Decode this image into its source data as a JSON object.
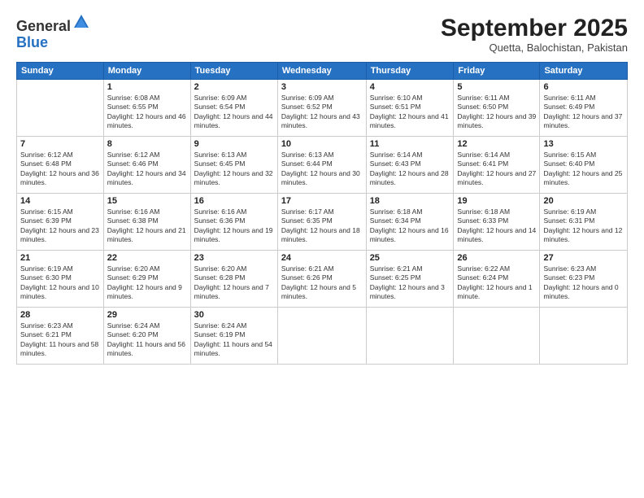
{
  "logo": {
    "general": "General",
    "blue": "Blue"
  },
  "header": {
    "month": "September 2025",
    "location": "Quetta, Balochistan, Pakistan"
  },
  "weekdays": [
    "Sunday",
    "Monday",
    "Tuesday",
    "Wednesday",
    "Thursday",
    "Friday",
    "Saturday"
  ],
  "weeks": [
    [
      {
        "day": "",
        "empty": true
      },
      {
        "day": "1",
        "sunrise": "6:08 AM",
        "sunset": "6:55 PM",
        "daylight": "12 hours and 46 minutes."
      },
      {
        "day": "2",
        "sunrise": "6:09 AM",
        "sunset": "6:54 PM",
        "daylight": "12 hours and 44 minutes."
      },
      {
        "day": "3",
        "sunrise": "6:09 AM",
        "sunset": "6:52 PM",
        "daylight": "12 hours and 43 minutes."
      },
      {
        "day": "4",
        "sunrise": "6:10 AM",
        "sunset": "6:51 PM",
        "daylight": "12 hours and 41 minutes."
      },
      {
        "day": "5",
        "sunrise": "6:11 AM",
        "sunset": "6:50 PM",
        "daylight": "12 hours and 39 minutes."
      },
      {
        "day": "6",
        "sunrise": "6:11 AM",
        "sunset": "6:49 PM",
        "daylight": "12 hours and 37 minutes."
      }
    ],
    [
      {
        "day": "7",
        "sunrise": "6:12 AM",
        "sunset": "6:48 PM",
        "daylight": "12 hours and 36 minutes."
      },
      {
        "day": "8",
        "sunrise": "6:12 AM",
        "sunset": "6:46 PM",
        "daylight": "12 hours and 34 minutes."
      },
      {
        "day": "9",
        "sunrise": "6:13 AM",
        "sunset": "6:45 PM",
        "daylight": "12 hours and 32 minutes."
      },
      {
        "day": "10",
        "sunrise": "6:13 AM",
        "sunset": "6:44 PM",
        "daylight": "12 hours and 30 minutes."
      },
      {
        "day": "11",
        "sunrise": "6:14 AM",
        "sunset": "6:43 PM",
        "daylight": "12 hours and 28 minutes."
      },
      {
        "day": "12",
        "sunrise": "6:14 AM",
        "sunset": "6:41 PM",
        "daylight": "12 hours and 27 minutes."
      },
      {
        "day": "13",
        "sunrise": "6:15 AM",
        "sunset": "6:40 PM",
        "daylight": "12 hours and 25 minutes."
      }
    ],
    [
      {
        "day": "14",
        "sunrise": "6:15 AM",
        "sunset": "6:39 PM",
        "daylight": "12 hours and 23 minutes."
      },
      {
        "day": "15",
        "sunrise": "6:16 AM",
        "sunset": "6:38 PM",
        "daylight": "12 hours and 21 minutes."
      },
      {
        "day": "16",
        "sunrise": "6:16 AM",
        "sunset": "6:36 PM",
        "daylight": "12 hours and 19 minutes."
      },
      {
        "day": "17",
        "sunrise": "6:17 AM",
        "sunset": "6:35 PM",
        "daylight": "12 hours and 18 minutes."
      },
      {
        "day": "18",
        "sunrise": "6:18 AM",
        "sunset": "6:34 PM",
        "daylight": "12 hours and 16 minutes."
      },
      {
        "day": "19",
        "sunrise": "6:18 AM",
        "sunset": "6:33 PM",
        "daylight": "12 hours and 14 minutes."
      },
      {
        "day": "20",
        "sunrise": "6:19 AM",
        "sunset": "6:31 PM",
        "daylight": "12 hours and 12 minutes."
      }
    ],
    [
      {
        "day": "21",
        "sunrise": "6:19 AM",
        "sunset": "6:30 PM",
        "daylight": "12 hours and 10 minutes."
      },
      {
        "day": "22",
        "sunrise": "6:20 AM",
        "sunset": "6:29 PM",
        "daylight": "12 hours and 9 minutes."
      },
      {
        "day": "23",
        "sunrise": "6:20 AM",
        "sunset": "6:28 PM",
        "daylight": "12 hours and 7 minutes."
      },
      {
        "day": "24",
        "sunrise": "6:21 AM",
        "sunset": "6:26 PM",
        "daylight": "12 hours and 5 minutes."
      },
      {
        "day": "25",
        "sunrise": "6:21 AM",
        "sunset": "6:25 PM",
        "daylight": "12 hours and 3 minutes."
      },
      {
        "day": "26",
        "sunrise": "6:22 AM",
        "sunset": "6:24 PM",
        "daylight": "12 hours and 1 minute."
      },
      {
        "day": "27",
        "sunrise": "6:23 AM",
        "sunset": "6:23 PM",
        "daylight": "12 hours and 0 minutes."
      }
    ],
    [
      {
        "day": "28",
        "sunrise": "6:23 AM",
        "sunset": "6:21 PM",
        "daylight": "11 hours and 58 minutes."
      },
      {
        "day": "29",
        "sunrise": "6:24 AM",
        "sunset": "6:20 PM",
        "daylight": "11 hours and 56 minutes."
      },
      {
        "day": "30",
        "sunrise": "6:24 AM",
        "sunset": "6:19 PM",
        "daylight": "11 hours and 54 minutes."
      },
      {
        "day": "",
        "empty": true
      },
      {
        "day": "",
        "empty": true
      },
      {
        "day": "",
        "empty": true
      },
      {
        "day": "",
        "empty": true
      }
    ]
  ]
}
